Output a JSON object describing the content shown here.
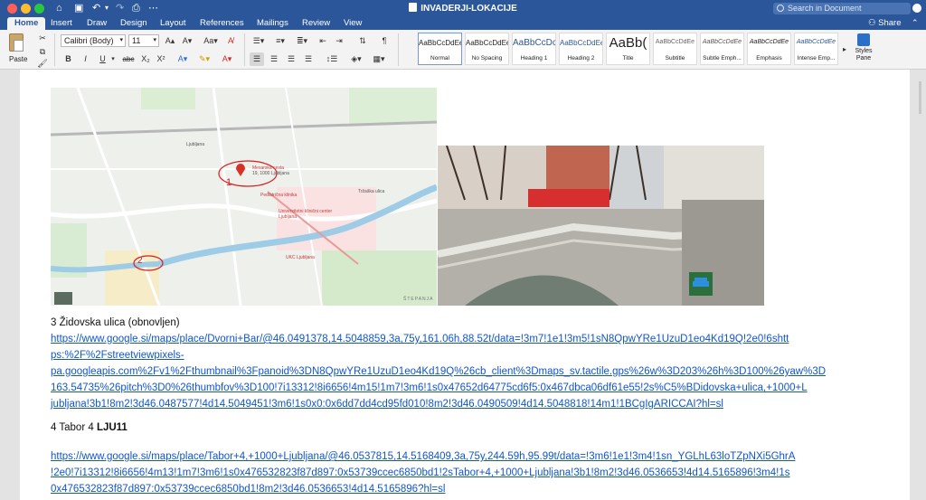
{
  "window": {
    "title": "INVADERJI-LOKACIJE",
    "search_placeholder": "Search in Document"
  },
  "tabs": [
    "Home",
    "Insert",
    "Draw",
    "Design",
    "Layout",
    "References",
    "Mailings",
    "Review",
    "View"
  ],
  "share_label": "Share",
  "ribbon": {
    "paste_label": "Paste",
    "font_name": "Calibri (Body)",
    "font_size": "11",
    "styles": [
      {
        "preview": "AaBbCcDdEe",
        "name": "Normal"
      },
      {
        "preview": "AaBbCcDdEe",
        "name": "No Spacing"
      },
      {
        "preview": "AaBbCcDc",
        "name": "Heading 1"
      },
      {
        "preview": "AaBbCcDdEe",
        "name": "Heading 2"
      },
      {
        "preview": "AaBb(",
        "name": "Title"
      },
      {
        "preview": "AaBbCcDdEe",
        "name": "Subtitle"
      },
      {
        "preview": "AaBbCcDdEe",
        "name": "Subtle Emph..."
      },
      {
        "preview": "AaBbCcDdEe",
        "name": "Emphasis"
      },
      {
        "preview": "AaBbCcDdEe",
        "name": "Intense Emp..."
      }
    ],
    "styles_pane_label_1": "Styles",
    "styles_pane_label_2": "Pane"
  },
  "colors": {
    "accent": "#2b579a",
    "link": "#1155cc"
  },
  "document": {
    "map_labels": {
      "place_callout_1": "Mesarska cesta",
      "place_callout_2": "19, 1000 Ljubljana",
      "station": "Ljubljana",
      "marker_digit": "1",
      "marker_digit_2": "2",
      "place_a": "Pediatrična klinika",
      "place_b": "UKC Ljubljana",
      "place_c": "Tržaška ulica",
      "place_d": "Univerzitetni klinični center Ljubljana",
      "watermark": "ŠTEPANJA"
    },
    "entry3_title": "3 Židovska ulica (obnovljen)",
    "entry3_link_lines": [
      "https://www.google.si/maps/place/Dvorni+Bar/@46.0491378,14.5048859,3a,75y,161.06h,88.52t/data=!3m7!1e1!3m5!1sN8QpwYRe1UzuD1eo4Kd19Q!2e0!6shtt",
      "ps:%2F%2Fstreetviewpixels-",
      "pa.googleapis.com%2Fv1%2Fthumbnail%3Fpanoid%3DN8QpwYRe1UzuD1eo4Kd19Q%26cb_client%3Dmaps_sv.tactile.gps%26w%3D203%26h%3D100%26yaw%3D",
      "163.54735%26pitch%3D0%26thumbfov%3D100!7i13312!8i6656!4m15!1m7!3m6!1s0x47652d64775cd6f5:0x467dbca06df61e55!2s%C5%BDidovska+ulica,+1000+L",
      "jubljana!3b1!8m2!3d46.0487577!4d14.5049451!3m6!1s0x0:0x6dd7dd4cd95fd010!8m2!3d46.0490509!4d14.5048818!14m1!1BCgIgARICCAI?hl=sl"
    ],
    "entry4_title_plain": "4 Tabor 4 ",
    "entry4_title_bold": "LJU11",
    "entry4_link_lines": [
      "https://www.google.si/maps/place/Tabor+4,+1000+Ljubljana/@46.0537815,14.5168409,3a,75y,244.59h,95.99t/data=!3m6!1e1!3m4!1sn_YGLhL63loTZpNXi5GhrA",
      "!2e0!7i13312!8i6656!4m13!1m7!3m6!1s0x476532823f87d897:0x53739ccec6850bd1!2sTabor+4,+1000+Ljubljana!3b1!8m2!3d46.0536653!4d14.5165896!3m4!1s",
      "0x476532823f87d897:0x53739ccec6850bd1!8m2!3d46.0536653!4d14.5165896?hl=sl"
    ]
  }
}
